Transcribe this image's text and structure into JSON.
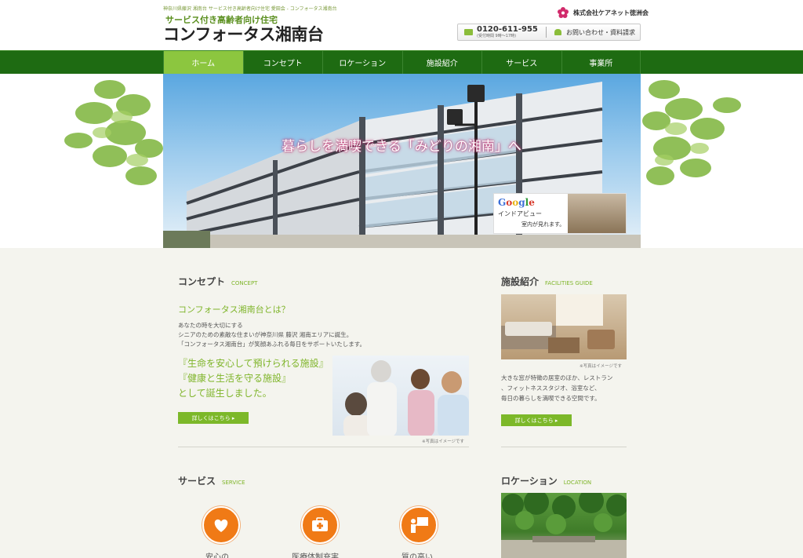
{
  "header": {
    "breadcrumb": "神奈川県藤沢 湘南台 サービス付き高齢者向け住宅 愛田会 - コンフォータス湘南台",
    "tagline": "サービス付き高齢者向け住宅",
    "site_title": "コンフォータス湘南台",
    "company": "株式会社ケアネット徳洲会",
    "phone": "0120-611-955",
    "phone_hours": "(受付時間 9時〜17時)",
    "inquiry": "お問い合わせ・資料請求"
  },
  "nav": {
    "items": [
      {
        "label": "ホーム"
      },
      {
        "label": "コンセプト"
      },
      {
        "label": "ロケーション"
      },
      {
        "label": "施設紹介"
      },
      {
        "label": "サービス"
      },
      {
        "label": "事業所"
      }
    ],
    "active_index": 0
  },
  "hero": {
    "catch": "暮らしを満喫できる「みどりの湘南」へ",
    "google_logo": "Google",
    "google_sub": "インドアビュー",
    "google_sub2": "室内が見れます。"
  },
  "concept": {
    "title": "コンセプト",
    "title_en": "CONCEPT",
    "question": "コンフォータス湘南台とは？",
    "body_line1": "あなたの時を大切にする",
    "body_line2": "シニアのための素敵な住まいが神奈川県 藤沢 湘南エリアに誕生。",
    "body_line3": "「コンフォータス湘南台」が笑顔あふれる毎日をサポートいたします。",
    "big_line1": "『生命を安心して預けられる施設』",
    "big_line2": "『健康と生活を守る施設』",
    "big_line3": "として誕生しました。",
    "photo_note": "※写真はイメージです",
    "more_button": "詳しくはこちら ▸"
  },
  "facilities": {
    "title": "施設紹介",
    "title_en": "FACILITIES GUIDE",
    "photo_note": "※写真はイメージです",
    "text_line1": "大きな窓が特徴の居室のほか、レストラン",
    "text_line2": "、フィットネススタジオ、浴室など、",
    "text_line3": "毎日の暮らしを満喫できる空間です。",
    "more_button": "詳しくはこちら ▸"
  },
  "service": {
    "title": "サービス",
    "title_en": "SERVICE",
    "items": [
      {
        "label": "安心の",
        "icon": "heart-icon"
      },
      {
        "label": "医療体制充実",
        "icon": "medical-kit-icon"
      },
      {
        "label": "質の高い",
        "icon": "lecture-icon"
      }
    ]
  },
  "location": {
    "title": "ロケーション",
    "title_en": "LOCATION"
  },
  "colors": {
    "nav_bg": "#1e6b12",
    "nav_active": "#8cc63f",
    "accent_green": "#7fb52a",
    "service_orange": "#f07a16"
  }
}
